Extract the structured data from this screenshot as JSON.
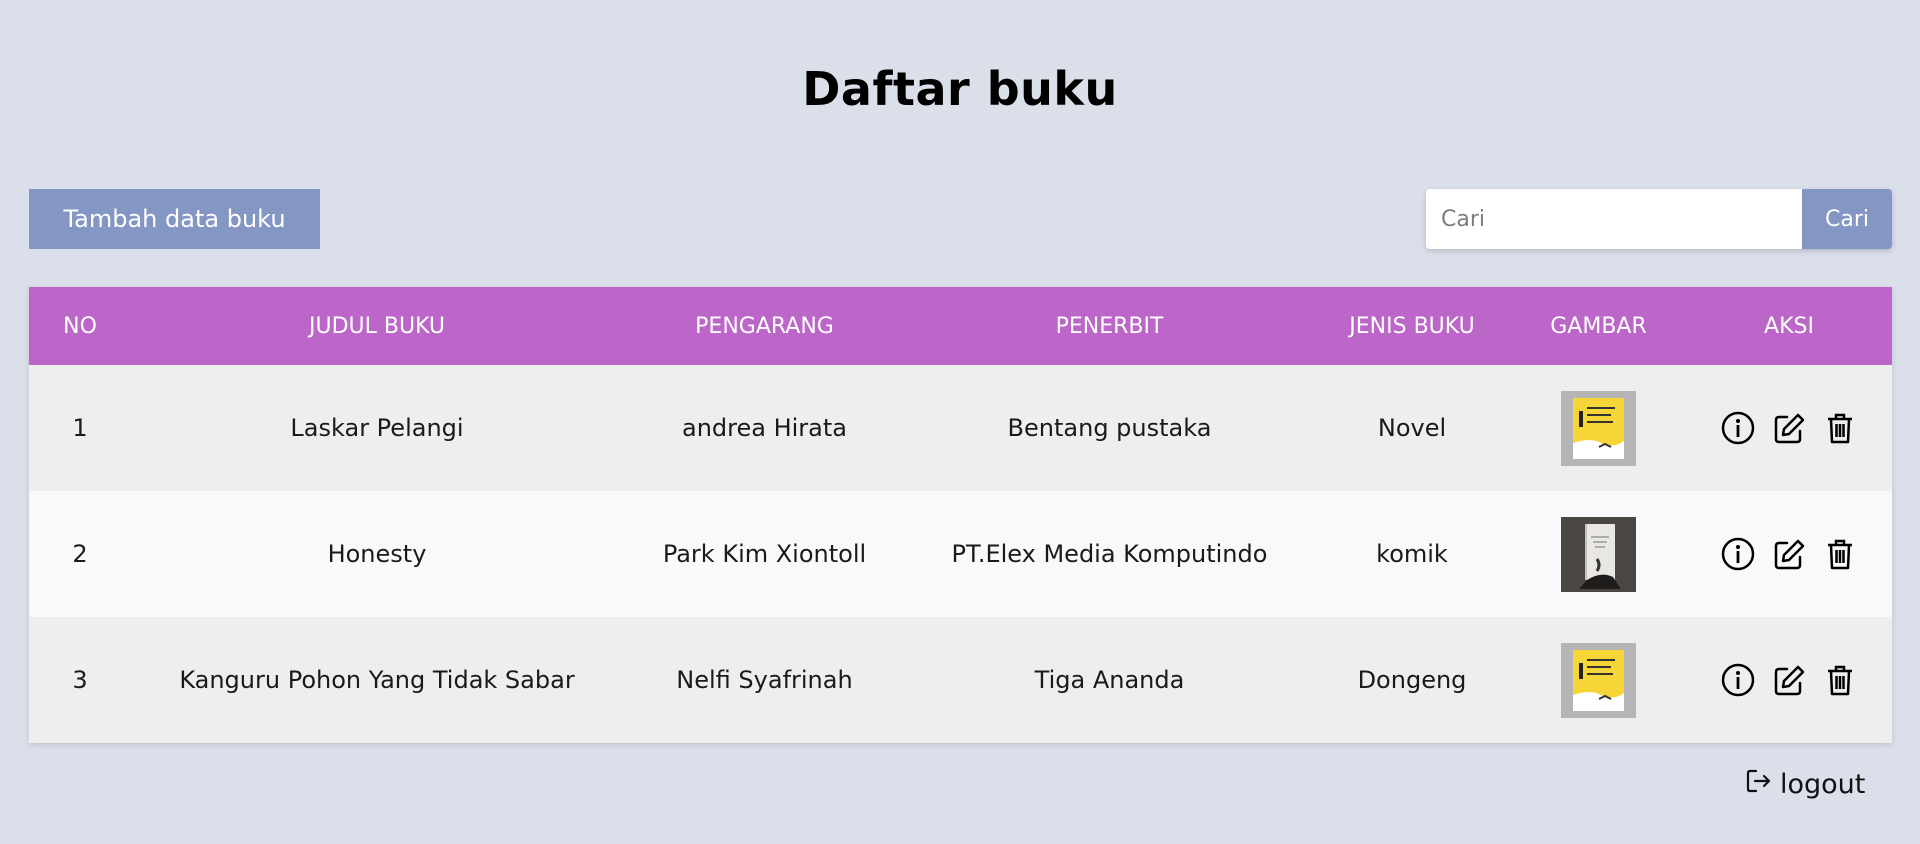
{
  "page": {
    "title": "Daftar buku"
  },
  "toolbar": {
    "add_label": "Tambah data buku",
    "search_placeholder": "Cari",
    "search_value": "",
    "search_button": "Cari"
  },
  "table": {
    "headers": [
      "NO",
      "JUDUL BUKU",
      "PENGARANG",
      "PENERBIT",
      "JENIS BUKU",
      "GAMBAR",
      "AKSI"
    ],
    "rows": [
      {
        "no": "1",
        "judul": "Laskar Pelangi",
        "pengarang": "andrea Hirata",
        "penerbit": "Bentang pustaka",
        "jenis": "Novel",
        "cover": "yellow-cover"
      },
      {
        "no": "2",
        "judul": "Honesty",
        "pengarang": "Park Kim Xiontoll",
        "penerbit": "PT.Elex Media Komputindo",
        "jenis": "komik",
        "cover": "dark-cover"
      },
      {
        "no": "3",
        "judul": "Kanguru Pohon Yang Tidak Sabar",
        "pengarang": "Nelfi Syafrinah",
        "penerbit": "Tiga Ananda",
        "jenis": "Dongeng",
        "cover": "yellow-cover"
      }
    ],
    "row_actions": [
      "info-icon",
      "edit-icon",
      "trash-icon"
    ]
  },
  "footer": {
    "logout_label": "logout",
    "logout_icon": "logout-icon"
  },
  "colors": {
    "background": "#dbdfea",
    "header": "#bb66c8",
    "button": "#8496c4",
    "row_odd": "#eeeeee",
    "row_even": "#f9f9f9"
  }
}
